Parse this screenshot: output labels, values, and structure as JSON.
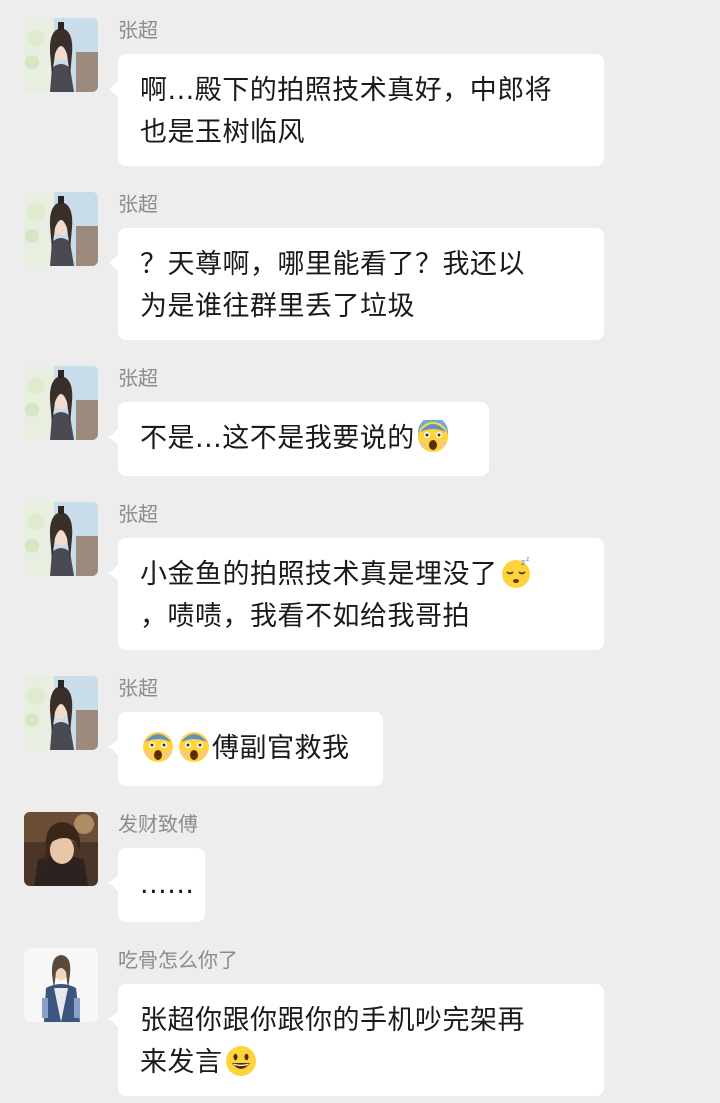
{
  "messages": [
    {
      "sender": "张超",
      "avatar": "zhang-chao-avatar",
      "lines": [
        "啊...殿下的拍照技术真好，中郎将",
        "也是玉树临风"
      ]
    },
    {
      "sender": "张超",
      "avatar": "zhang-chao-avatar",
      "lines": [
        "？天尊啊，哪里能看了？我还以",
        "为是谁往群里丢了垃圾"
      ]
    },
    {
      "sender": "张超",
      "avatar": "zhang-chao-avatar",
      "lines": [
        "不是...这不是我要说的"
      ],
      "emoji": "screaming-face-emoji"
    },
    {
      "sender": "张超",
      "avatar": "zhang-chao-avatar",
      "lines": [
        "小金鱼的拍照技术真是埋没了",
        "，啧啧，我看不如给我哥拍"
      ],
      "emoji": "sleeping-face-emoji"
    },
    {
      "sender": "张超",
      "avatar": "zhang-chao-avatar",
      "lines": [
        "傅副官救我"
      ],
      "emoji": "screaming-face-emoji"
    },
    {
      "sender": "发财致傅",
      "avatar": "fa-cai-avatar",
      "lines": [
        "......"
      ]
    },
    {
      "sender": "吃骨怎么你了",
      "avatar": "chi-gu-avatar",
      "lines": [
        "张超你跟你跟你的手机吵完架再",
        "来发言"
      ],
      "emoji": "smiling-face-emoji"
    }
  ],
  "colors": {
    "background": "#ededed",
    "bubble": "#ffffff",
    "sender_name": "#8c8c8c",
    "text": "#1a1a1a"
  }
}
